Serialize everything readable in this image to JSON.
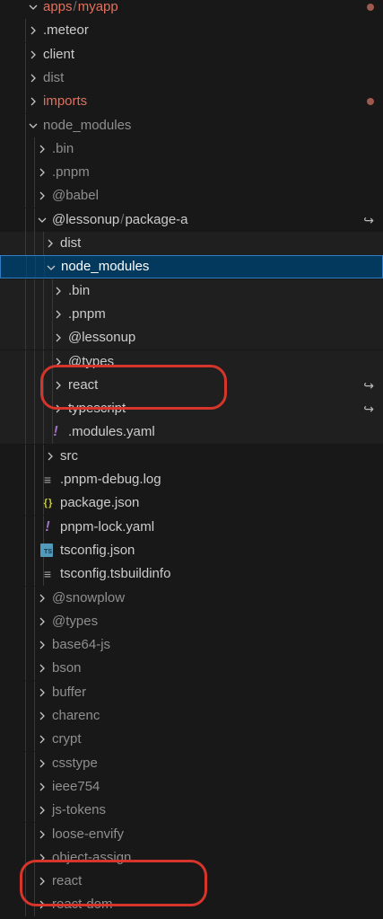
{
  "rows": [
    {
      "label": "apps",
      "label2": "myapp",
      "depth": 0,
      "chevron": "down",
      "style": "mod",
      "dot": true
    },
    {
      "label": ".meteor",
      "depth": 1,
      "chevron": "right"
    },
    {
      "label": "client",
      "depth": 1,
      "chevron": "right"
    },
    {
      "label": "dist",
      "depth": 1,
      "chevron": "right",
      "style": "dim"
    },
    {
      "label": "imports",
      "depth": 1,
      "chevron": "right",
      "style": "mod",
      "dot": true
    },
    {
      "label": "node_modules",
      "depth": 1,
      "chevron": "down",
      "style": "dim"
    },
    {
      "label": ".bin",
      "depth": 2,
      "chevron": "right",
      "style": "dim"
    },
    {
      "label": ".pnpm",
      "depth": 2,
      "chevron": "right",
      "style": "dim"
    },
    {
      "label": "@babel",
      "depth": 2,
      "chevron": "right",
      "style": "dim"
    },
    {
      "label": "@lessonup",
      "label2": "package-a",
      "depth": 2,
      "chevron": "down",
      "symlink": true
    },
    {
      "label": "dist",
      "depth": 3,
      "chevron": "right",
      "bg": true
    },
    {
      "label": "node_modules",
      "depth": 3,
      "chevron": "down",
      "selected": true
    },
    {
      "label": ".bin",
      "depth": 4,
      "chevron": "right",
      "bg": true
    },
    {
      "label": ".pnpm",
      "depth": 4,
      "chevron": "right",
      "bg": true
    },
    {
      "label": "@lessonup",
      "depth": 4,
      "chevron": "right",
      "bg": true
    },
    {
      "label": "@types",
      "depth": 4,
      "chevron": "right",
      "bg": true
    },
    {
      "label": "react",
      "depth": 4,
      "chevron": "right",
      "bg": true,
      "symlink": true
    },
    {
      "label": "typescript",
      "depth": 4,
      "chevron": "right",
      "bg": true,
      "symlink": true
    },
    {
      "label": ".modules.yaml",
      "depth": 4,
      "icon": "bang",
      "bg": true
    },
    {
      "label": "src",
      "depth": 3,
      "chevron": "right"
    },
    {
      "label": ".pnpm-debug.log",
      "depth": 3,
      "icon": "lines"
    },
    {
      "label": "package.json",
      "depth": 3,
      "icon": "braces"
    },
    {
      "label": "pnpm-lock.yaml",
      "depth": 3,
      "icon": "bang"
    },
    {
      "label": "tsconfig.json",
      "depth": 3,
      "icon": "ts"
    },
    {
      "label": "tsconfig.tsbuildinfo",
      "depth": 3,
      "icon": "lines"
    },
    {
      "label": "@snowplow",
      "depth": 2,
      "chevron": "right",
      "style": "dim"
    },
    {
      "label": "@types",
      "depth": 2,
      "chevron": "right",
      "style": "dim"
    },
    {
      "label": "base64-js",
      "depth": 2,
      "chevron": "right",
      "style": "dim"
    },
    {
      "label": "bson",
      "depth": 2,
      "chevron": "right",
      "style": "dim"
    },
    {
      "label": "buffer",
      "depth": 2,
      "chevron": "right",
      "style": "dim"
    },
    {
      "label": "charenc",
      "depth": 2,
      "chevron": "right",
      "style": "dim"
    },
    {
      "label": "crypt",
      "depth": 2,
      "chevron": "right",
      "style": "dim"
    },
    {
      "label": "csstype",
      "depth": 2,
      "chevron": "right",
      "style": "dim"
    },
    {
      "label": "ieee754",
      "depth": 2,
      "chevron": "right",
      "style": "dim"
    },
    {
      "label": "js-tokens",
      "depth": 2,
      "chevron": "right",
      "style": "dim"
    },
    {
      "label": "loose-envify",
      "depth": 2,
      "chevron": "right",
      "style": "dim"
    },
    {
      "label": "object-assign",
      "depth": 2,
      "chevron": "right",
      "style": "dim"
    },
    {
      "label": "react",
      "depth": 2,
      "chevron": "right",
      "style": "dim"
    },
    {
      "label": "react-dom",
      "depth": 2,
      "chevron": "right",
      "style": "dim"
    }
  ],
  "annotations": [
    {
      "row": 16,
      "color": "#d5352b"
    },
    {
      "row": 37,
      "color": "#d5352b"
    }
  ],
  "icons": {
    "chevron_right": "chevron-right-icon",
    "chevron_down": "chevron-down-icon",
    "symlink": "symlink-arrow-icon",
    "modified": "modified-dot-icon"
  },
  "colors": {
    "background": "#181818",
    "selected_bg": "#04395e",
    "selected_border": "#2f7ec4",
    "modified": "#e2705f",
    "annotation": "#d5352b"
  }
}
